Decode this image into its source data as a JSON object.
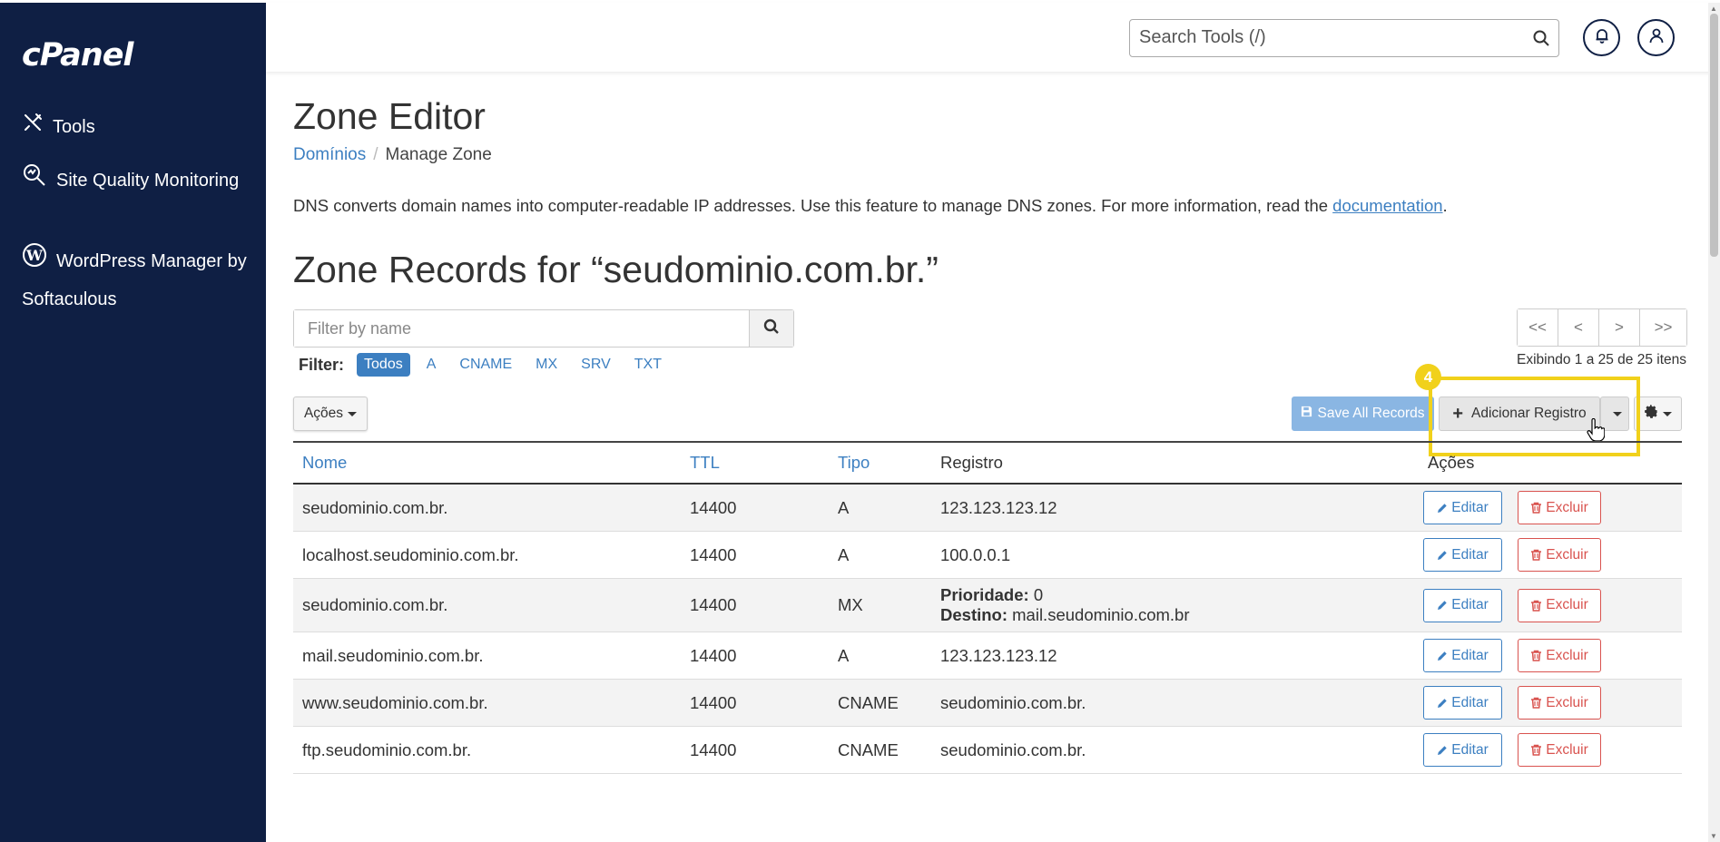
{
  "sidebar": {
    "logo": "cPanel",
    "items": [
      {
        "label": "Tools",
        "icon": "tools-icon"
      },
      {
        "label": "Site Quality Monitoring",
        "icon": "site-quality-icon"
      },
      {
        "label": "WordPress Manager by Softaculous",
        "icon": "wordpress-icon"
      }
    ]
  },
  "header": {
    "search_placeholder": "Search Tools (/)"
  },
  "page": {
    "title": "Zone Editor",
    "breadcrumb": {
      "parent": "Domínios",
      "current": "Manage Zone"
    },
    "description": "DNS converts domain names into computer-readable IP addresses. Use this feature to manage DNS zones. For more information, read the ",
    "description_link": "documentation",
    "description_end": ".",
    "section_title": "Zone Records for “seudominio.com.br.”"
  },
  "filter": {
    "placeholder": "Filter by name",
    "label": "Filter:",
    "chips": [
      "Todos",
      "A",
      "CNAME",
      "MX",
      "SRV",
      "TXT"
    ],
    "active": "Todos"
  },
  "pager": {
    "first": "<<",
    "prev": "<",
    "next": ">",
    "last": ">>",
    "info": "Exibindo 1 a 25 de 25 itens"
  },
  "toolbar": {
    "acoes": "Ações",
    "save": "Save All Records",
    "add": "Adicionar Registro",
    "step_badge": "4"
  },
  "table": {
    "headers": {
      "name": "Nome",
      "ttl": "TTL",
      "type": "Tipo",
      "record": "Registro",
      "actions": "Ações"
    },
    "edit_label": "Editar",
    "delete_label": "Excluir",
    "priority_label": "Prioridade:",
    "target_label": "Destino:",
    "rows": [
      {
        "name": "seudominio.com.br.",
        "ttl": "14400",
        "type": "A",
        "record": "123.123.123.12"
      },
      {
        "name": "localhost.seudominio.com.br.",
        "ttl": "14400",
        "type": "A",
        "record": "100.0.0.1"
      },
      {
        "name": "seudominio.com.br.",
        "ttl": "14400",
        "type": "MX",
        "priority": "0",
        "target": "mail.seudominio.com.br"
      },
      {
        "name": "mail.seudominio.com.br.",
        "ttl": "14400",
        "type": "A",
        "record": "123.123.123.12"
      },
      {
        "name": "www.seudominio.com.br.",
        "ttl": "14400",
        "type": "CNAME",
        "record": "seudominio.com.br."
      },
      {
        "name": "ftp.seudominio.com.br.",
        "ttl": "14400",
        "type": "CNAME",
        "record": "seudominio.com.br."
      }
    ]
  },
  "colors": {
    "sidebar_bg": "#0f1f44",
    "link": "#3c7fc1",
    "danger": "#d9534f",
    "highlight": "#f1d11b"
  }
}
